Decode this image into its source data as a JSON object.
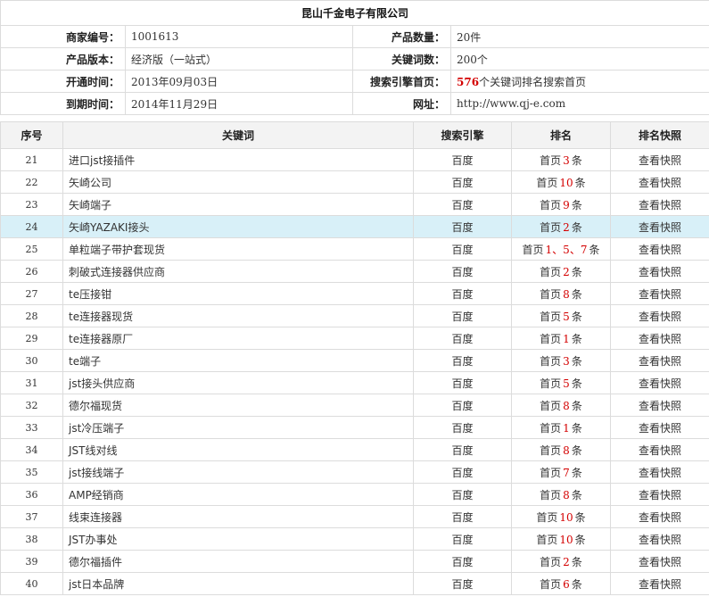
{
  "company": "昆山千金电子有限公司",
  "info": {
    "merchant_id_label": "商家编号：",
    "merchant_id": "1001613",
    "product_count_label": "产品数量：",
    "product_count": "20件",
    "version_label": "产品版本：",
    "version": "经济版（一站式）",
    "keyword_count_label": "关键词数：",
    "keyword_count": "200个",
    "open_time_label": "开通时间：",
    "open_time": "2013年09月03日",
    "se_home_label": "搜索引擎首页：",
    "se_home_count": "576",
    "se_home_suffix": "个关键词排名搜索首页",
    "expire_label": "到期时间：",
    "expire_time": "2014年11月29日",
    "url_label": "网址：",
    "url": "http://www.qj-e.com"
  },
  "table": {
    "headers": [
      "序号",
      "关键词",
      "搜索引擎",
      "排名",
      "排名快照"
    ],
    "rows": [
      {
        "seq": "21",
        "keyword": "进口jst接插件",
        "engine": "百度",
        "rank_pre": "首页",
        "rank_num": "3",
        "rank_suf": "条",
        "snapshot": "查看快照"
      },
      {
        "seq": "22",
        "keyword": "矢崎公司",
        "engine": "百度",
        "rank_pre": "首页",
        "rank_num": "10",
        "rank_suf": "条",
        "snapshot": "查看快照"
      },
      {
        "seq": "23",
        "keyword": "矢崎端子",
        "engine": "百度",
        "rank_pre": "首页",
        "rank_num": "9",
        "rank_suf": "条",
        "snapshot": "查看快照"
      },
      {
        "seq": "24",
        "keyword": "矢崎YAZAKI接头",
        "engine": "百度",
        "rank_pre": "首页",
        "rank_num": "2",
        "rank_suf": "条",
        "snapshot": "查看快照",
        "highlight": true
      },
      {
        "seq": "25",
        "keyword": "单粒端子带护套现货",
        "engine": "百度",
        "rank_pre": "首页",
        "rank_num": "1、5、7",
        "rank_suf": "条",
        "snapshot": "查看快照"
      },
      {
        "seq": "26",
        "keyword": "刺破式连接器供应商",
        "engine": "百度",
        "rank_pre": "首页",
        "rank_num": "2",
        "rank_suf": "条",
        "snapshot": "查看快照"
      },
      {
        "seq": "27",
        "keyword": "te压接钳",
        "engine": "百度",
        "rank_pre": "首页",
        "rank_num": "8",
        "rank_suf": "条",
        "snapshot": "查看快照"
      },
      {
        "seq": "28",
        "keyword": "te连接器现货",
        "engine": "百度",
        "rank_pre": "首页",
        "rank_num": "5",
        "rank_suf": "条",
        "snapshot": "查看快照"
      },
      {
        "seq": "29",
        "keyword": "te连接器原厂",
        "engine": "百度",
        "rank_pre": "首页",
        "rank_num": "1",
        "rank_suf": "条",
        "snapshot": "查看快照"
      },
      {
        "seq": "30",
        "keyword": "te端子",
        "engine": "百度",
        "rank_pre": "首页",
        "rank_num": "3",
        "rank_suf": "条",
        "snapshot": "查看快照"
      },
      {
        "seq": "31",
        "keyword": "jst接头供应商",
        "engine": "百度",
        "rank_pre": "首页",
        "rank_num": "5",
        "rank_suf": "条",
        "snapshot": "查看快照"
      },
      {
        "seq": "32",
        "keyword": "德尔福现货",
        "engine": "百度",
        "rank_pre": "首页",
        "rank_num": "8",
        "rank_suf": "条",
        "snapshot": "查看快照"
      },
      {
        "seq": "33",
        "keyword": "jst冷压端子",
        "engine": "百度",
        "rank_pre": "首页",
        "rank_num": "1",
        "rank_suf": "条",
        "snapshot": "查看快照"
      },
      {
        "seq": "34",
        "keyword": "JST线对线",
        "engine": "百度",
        "rank_pre": "首页",
        "rank_num": "8",
        "rank_suf": "条",
        "snapshot": "查看快照"
      },
      {
        "seq": "35",
        "keyword": "jst接线端子",
        "engine": "百度",
        "rank_pre": "首页",
        "rank_num": "7",
        "rank_suf": "条",
        "snapshot": "查看快照"
      },
      {
        "seq": "36",
        "keyword": "AMP经销商",
        "engine": "百度",
        "rank_pre": "首页",
        "rank_num": "8",
        "rank_suf": "条",
        "snapshot": "查看快照"
      },
      {
        "seq": "37",
        "keyword": "线束连接器",
        "engine": "百度",
        "rank_pre": "首页",
        "rank_num": "10",
        "rank_suf": "条",
        "snapshot": "查看快照"
      },
      {
        "seq": "38",
        "keyword": "JST办事处",
        "engine": "百度",
        "rank_pre": "首页",
        "rank_num": "10",
        "rank_suf": "条",
        "snapshot": "查看快照"
      },
      {
        "seq": "39",
        "keyword": "德尔福插件",
        "engine": "百度",
        "rank_pre": "首页",
        "rank_num": "2",
        "rank_suf": "条",
        "snapshot": "查看快照"
      },
      {
        "seq": "40",
        "keyword": "jst日本品牌",
        "engine": "百度",
        "rank_pre": "首页",
        "rank_num": "6",
        "rank_suf": "条",
        "snapshot": "查看快照"
      }
    ]
  }
}
